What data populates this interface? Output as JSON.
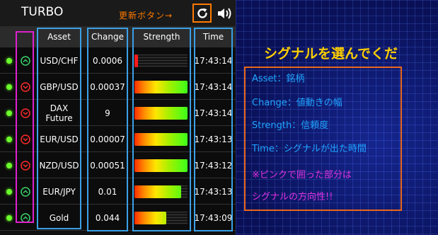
{
  "app": {
    "title": "TURBO",
    "refresh_annotation": "更新ボタン→"
  },
  "columns": [
    "Asset",
    "Change",
    "Strength",
    "Time"
  ],
  "rows": [
    {
      "direction": "up",
      "asset": "USD/CHF",
      "change": "0.0006",
      "strength": 0.06,
      "time": "17:43:14"
    },
    {
      "direction": "down",
      "asset": "GBP/USD",
      "change": "0.00037",
      "strength": 1.0,
      "time": "17:43:14"
    },
    {
      "direction": "down",
      "asset": "DAX\nFuture",
      "change": "9",
      "strength": 1.0,
      "time": "17:43:14"
    },
    {
      "direction": "down",
      "asset": "EUR/USD",
      "change": "0.00007",
      "strength": 1.0,
      "time": "17:43:13"
    },
    {
      "direction": "down",
      "asset": "NZD/USD",
      "change": "0.00051",
      "strength": 1.0,
      "time": "17:43:12"
    },
    {
      "direction": "up",
      "asset": "EUR/JPY",
      "change": "0.01",
      "strength": 0.88,
      "time": "17:43:13"
    },
    {
      "direction": "up",
      "asset": "Gold",
      "change": "0.044",
      "strength": 0.6,
      "time": "17:43:09"
    }
  ],
  "panel": {
    "heading": "シグナルを選んでくだ",
    "legend": [
      "Asset：銘柄",
      "Change：値動きの幅",
      "Strength：信頼度",
      "Time：シグナルが出た時間"
    ],
    "note": [
      "※ピンクで囲った部分は",
      "シグナルの方向性!!"
    ]
  },
  "colors": {
    "up": "#3ad36a",
    "down": "#ff2a2a",
    "accent_blue": "#3aa0e6",
    "accent_pink": "#e020d0",
    "accent_orange": "#ff7a00"
  }
}
